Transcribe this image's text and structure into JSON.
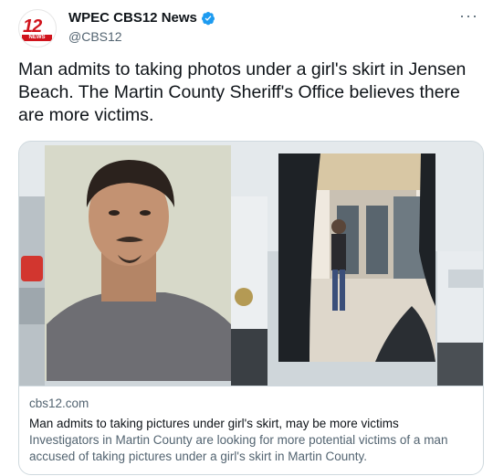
{
  "author": {
    "name": "WPEC CBS12 News",
    "handle": "@CBS12",
    "avatar_text": "12",
    "avatar_sub": "NEWS",
    "verified_color": "#1d9bf0"
  },
  "more_label": "···",
  "tweet": {
    "text": "Man admits to taking photos under a girl's skirt in Jensen Beach. The Martin County Sheriff's Office believes there are more victims."
  },
  "card": {
    "domain": "cbs12.com",
    "title": "Man admits to taking pictures under girl's skirt, may be more victims",
    "description": "Investigators in Martin County are looking for more potential victims of a man accused of taking pictures under a girl's skirt in Martin County."
  },
  "colors": {
    "brand_red": "#d0131c",
    "text_primary": "#0f1419",
    "text_secondary": "#536471",
    "border": "#cfd9de"
  }
}
